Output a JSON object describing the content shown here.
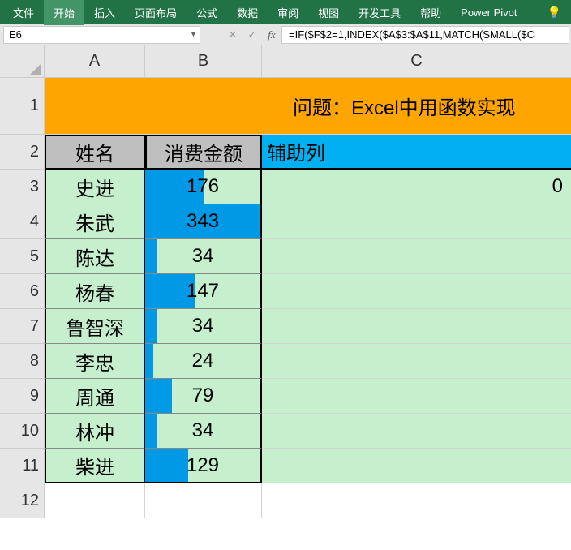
{
  "ribbon": {
    "tabs": [
      "文件",
      "开始",
      "插入",
      "页面布局",
      "公式",
      "数据",
      "审阅",
      "视图",
      "开发工具",
      "帮助",
      "Power Pivot"
    ],
    "active_index": 1,
    "lightbulb": "💡"
  },
  "formula_bar": {
    "name_box": "E6",
    "cancel": "✕",
    "enter": "✓",
    "fx": "fx",
    "formula": "=IF($F$2=1,INDEX($A$3:$A$11,MATCH(SMALL($C"
  },
  "columns": [
    "A",
    "B",
    "C"
  ],
  "row_numbers": [
    "1",
    "2",
    "3",
    "4",
    "5",
    "6",
    "7",
    "8",
    "9",
    "10",
    "11",
    "12"
  ],
  "title": "问题：Excel中用函数实现",
  "headers": {
    "a": "姓名",
    "b": "消费金额",
    "c": "辅助列"
  },
  "rows": [
    {
      "a": "史进",
      "b": 176,
      "c": "0"
    },
    {
      "a": "朱武",
      "b": 343,
      "c": ""
    },
    {
      "a": "陈达",
      "b": 34,
      "c": ""
    },
    {
      "a": "杨春",
      "b": 147,
      "c": ""
    },
    {
      "a": "鲁智深",
      "b": 34,
      "c": ""
    },
    {
      "a": "李忠",
      "b": 24,
      "c": ""
    },
    {
      "a": "周通",
      "b": 79,
      "c": ""
    },
    {
      "a": "林冲",
      "b": 34,
      "c": ""
    },
    {
      "a": "柴进",
      "b": 129,
      "c": ""
    }
  ],
  "chart_data": {
    "type": "bar",
    "title": "消费金额",
    "categories": [
      "史进",
      "朱武",
      "陈达",
      "杨春",
      "鲁智深",
      "李忠",
      "周通",
      "林冲",
      "柴进"
    ],
    "values": [
      176,
      343,
      34,
      147,
      34,
      24,
      79,
      34,
      129
    ],
    "xlabel": "姓名",
    "ylabel": "消费金额",
    "max": 343
  },
  "colors": {
    "ribbon": "#217346",
    "title_bg": "#ffa500",
    "header_ab": "#bfbfbf",
    "header_c": "#00b0f0",
    "data_bg": "#c6efce",
    "databar": "#0099e6"
  }
}
